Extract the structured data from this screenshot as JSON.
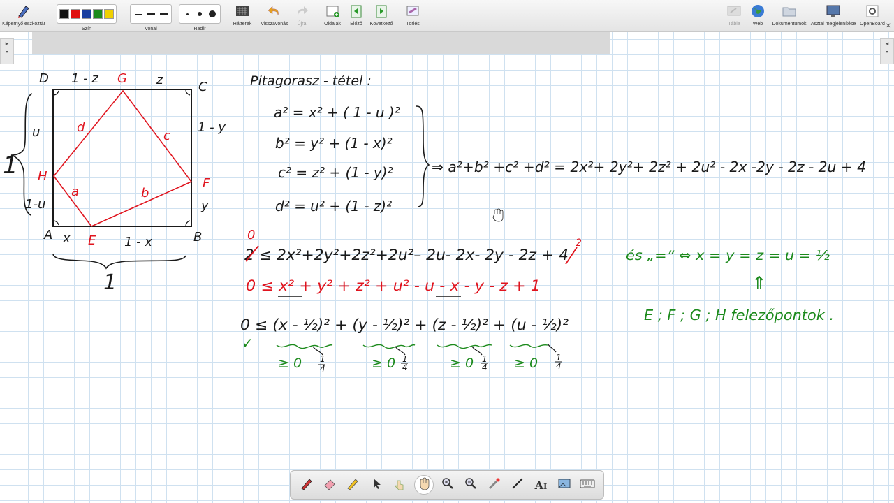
{
  "toolbar": {
    "items": [
      {
        "label": "Képernyő eszköztár",
        "icon": "pen-tool-icon"
      },
      {
        "label": "Szín",
        "icon": "color-palette-icon"
      },
      {
        "label": "Vonal",
        "icon": "line-width-icon"
      },
      {
        "label": "Radír",
        "icon": "eraser-size-icon"
      },
      {
        "label": "Hátterek",
        "icon": "background-icon"
      },
      {
        "label": "Visszavonás",
        "icon": "undo-icon"
      },
      {
        "label": "Újra",
        "icon": "redo-icon"
      },
      {
        "label": "Oldalak",
        "icon": "add-page-icon"
      },
      {
        "label": "Előző",
        "icon": "previous-page-icon"
      },
      {
        "label": "Következő",
        "icon": "next-page-icon"
      },
      {
        "label": "Törlés",
        "icon": "clear-page-icon"
      },
      {
        "label": "Tábla",
        "icon": "board-icon"
      },
      {
        "label": "Web",
        "icon": "globe-icon"
      },
      {
        "label": "Dokumentumok",
        "icon": "folder-icon"
      },
      {
        "label": "Asztal megjelenítése",
        "icon": "desktop-icon"
      },
      {
        "label": "OpenBoard",
        "icon": "gear-icon"
      }
    ],
    "colors": [
      "#111111",
      "#e01010",
      "#1a3fa0",
      "#1c8a1c",
      "#f0d000"
    ]
  },
  "board": {
    "square": {
      "corners": {
        "D": "D",
        "G": "G",
        "C": "C",
        "H": "H",
        "F": "F",
        "A": "A",
        "E": "E",
        "B": "B"
      },
      "top_left": "1 - z",
      "top_right": "z",
      "right_top": "1 - y",
      "right_bottom": "y",
      "left_top": "u",
      "left_bottom": "1-u",
      "left_one": "1",
      "bottom_left": "x",
      "bottom_right": "1 - x",
      "bottom_one": "1",
      "sides": {
        "a": "a",
        "b": "b",
        "c": "c",
        "d": "d"
      }
    },
    "pythagoras": {
      "title": "Pitagorasz - tétel :",
      "eq1": "a² = x² + ( 1 - u )²",
      "eq2": "b² = y² + (1 - x)²",
      "eq3": "c² = z² + (1 - y)²",
      "eq4": "d² = u² + (1 - z)²",
      "sum": "⇒ a²+b² +c² +d² = 2x²+ 2y²+ 2z² + 2u² - 2x -2y - 2z - 2u + 4"
    },
    "ineq1": {
      "zero": "0",
      "text": "2 ≤ 2x²+2y²+2z²+2u²– 2u- 2x- 2y - 2z + 4",
      "exp": "2"
    },
    "ineq2": "0 ≤ x² + y² + z² + u² - u - x - y - z + 1",
    "ineq3": {
      "text": "0 ≤ (x - ½)² + (y - ½)² + (z - ½)² + (u - ½)²",
      "check": "✓",
      "ge": [
        "≥ 0",
        "≥ 0",
        "≥ 0",
        "≥ 0"
      ],
      "quarter": [
        "1",
        "4"
      ]
    },
    "equality": "és „=” ⇔ x = y = z = u = ½",
    "arrow": "⇑",
    "midpoints": "E ; F ; G ; H felezőpontok ."
  },
  "dock": [
    "pen-icon",
    "eraser-icon",
    "highlighter-icon",
    "pointer-icon",
    "interact-icon",
    "hand-icon",
    "zoom-in-icon",
    "zoom-out-icon",
    "laser-icon",
    "line-icon",
    "text-icon",
    "capture-icon",
    "keyboard-icon"
  ],
  "colors": {
    "ink_black": "#1a1a1a",
    "ink_red": "#e0141e",
    "ink_green": "#1c8a1c"
  }
}
